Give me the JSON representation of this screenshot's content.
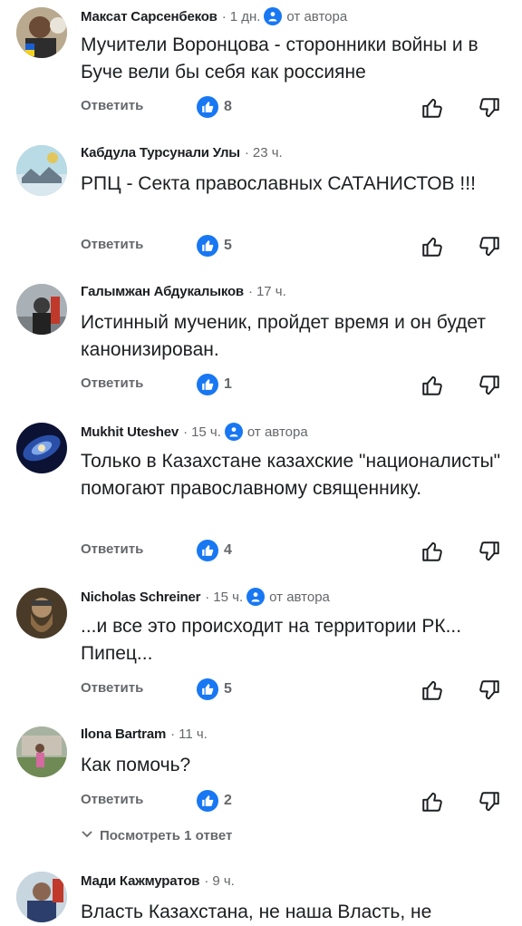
{
  "comments": [
    {
      "author": "Максат Сарсенбеков",
      "time": "1 дн.",
      "op": "от автора",
      "text": "Мучители Воронцова - сторонники войны и в Буче вели бы себя как россияне",
      "reply": "Ответить",
      "likes": "8"
    },
    {
      "author": "Кабдула Турсунали Улы",
      "time": "23 ч.",
      "op": "",
      "text": "РПЦ - Секта православных САТАНИСТОВ !!!",
      "reply": "Ответить",
      "likes": "5"
    },
    {
      "author": "Галымжан Абдукалыков",
      "time": "17 ч.",
      "op": "",
      "text": "Истинный мученик, пройдет время и он будет канонизирован.",
      "reply": "Ответить",
      "likes": "1"
    },
    {
      "author": "Mukhit Uteshev",
      "time": "15 ч.",
      "op": "от автора",
      "text": "Только в Казахстане казахские \"националисты\" помогают православному священнику.",
      "reply": "Ответить",
      "likes": "4"
    },
    {
      "author": "Nicholas Schreiner",
      "time": "15 ч.",
      "op": "от автора",
      "text": "...и все это происходит на территории РК... Пипец...",
      "reply": "Ответить",
      "likes": "5"
    },
    {
      "author": "Ilona Bartram",
      "time": "11 ч.",
      "op": "",
      "text": "Как помочь?",
      "reply": "Ответить",
      "likes": "2",
      "view_replies": "Посмотреть 1 ответ"
    },
    {
      "author": "Мади Кажмуратов",
      "time": "9 ч.",
      "op": "",
      "text": "Власть Казахстана, не наша Власть, не"
    }
  ]
}
